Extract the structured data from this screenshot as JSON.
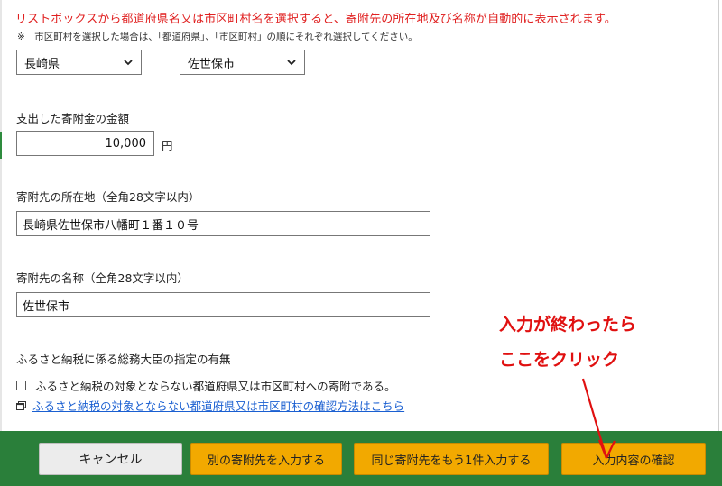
{
  "notice": {
    "main": "リストボックスから都道府県名又は市区町村名を選択すると、寄附先の所在地及び名称が自動的に表示されます。",
    "note": "※　市区町村を選択した場合は、「都道府県」、「市区町村」の順にそれぞれ選択してください。"
  },
  "selects": {
    "prefecture": "長崎県",
    "city": "佐世保市"
  },
  "amount": {
    "label": "支出した寄附金の金額",
    "value": "10,000",
    "unit": "円"
  },
  "address": {
    "label": "寄附先の所在地（全角28文字以内）",
    "value": "長崎県佐世保市八幡町１番１０号"
  },
  "name": {
    "label": "寄附先の名称（全角28文字以内）",
    "value": "佐世保市"
  },
  "designation": {
    "label": "ふるさと納税に係る総務大臣の指定の有無",
    "checkbox_label": "ふるさと納税の対象とならない都道府県又は市区町村への寄附である。",
    "link_text": "ふるさと納税の対象とならない都道府県又は市区町村の確認方法はこちら"
  },
  "annotation": {
    "line1": "入力が終わったら",
    "line2": "ここをクリック",
    "color": "#e01010"
  },
  "footer": {
    "cancel": "キャンセル",
    "other_donation": "別の寄附先を入力する",
    "same_donation": "同じ寄附先をもう1件入力する",
    "confirm": "入力内容の確認"
  },
  "colors": {
    "footer_bg": "#2a7f3a",
    "button_accent": "#f2a900",
    "notice_text": "#e02020",
    "link": "#1a5fd1"
  },
  "icons": {
    "dropdown": "chevron-down-icon",
    "external_window": "window-icon",
    "arrow": "arrow-annotation"
  }
}
